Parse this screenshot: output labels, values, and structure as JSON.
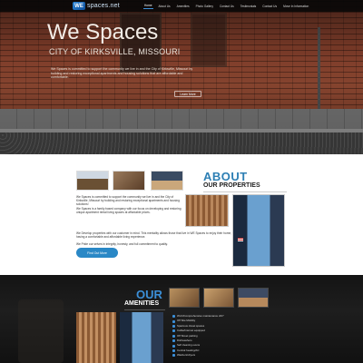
{
  "header": {
    "logo_mark": "WE",
    "logo_text": "spaces.net",
    "nav": [
      "Home",
      "About Us",
      "Amenities",
      "Photo Gallery",
      "Contact Us",
      "Testimonials",
      "Contact Us",
      "Move In Information"
    ]
  },
  "hero": {
    "title": "We Spaces",
    "subtitle": "CITY OF KIRKSVILLE, MISSOURI",
    "description": "We Spaces is committed to support the community we live in and the City of Kirksville, Missouri by building and restoring exceptional apartments and housing solutions that are affordable and comfortable.",
    "cta": "Learn More"
  },
  "about": {
    "title": "ABOUT",
    "subtitle": "OUR PROPERTIES",
    "para1": "We Spaces is committed to support the community we live in and the City of Kirksville, Missouri by building and restoring exceptional apartments and housing solutions!",
    "para2": "We Spaces is a family based company with our focus on developing and restoring unique apartment rental living spaces at affordable prices.",
    "para3": "We Develop properties with our customer in mind. This mentality allows those that live in WE Spaces to enjoy their home, while having a comfortable and affordable living experience.",
    "para4": "We Pride our selves in integrity, honesty, and full commitment to quality.",
    "button": "Find Out More"
  },
  "amenities": {
    "title": "OUR",
    "subtitle": "AMENITIES",
    "items": [
      "Wi-Fi/Comprehensive maintenance 24/7",
      "Off Site Mobility",
      "Spacious closet spaces",
      "Cable/Internet equipped",
      "Off Street parking",
      "Dishwashers",
      "Self cleaning ovens",
      "Central heating/AC",
      "Washers/dryers"
    ]
  }
}
